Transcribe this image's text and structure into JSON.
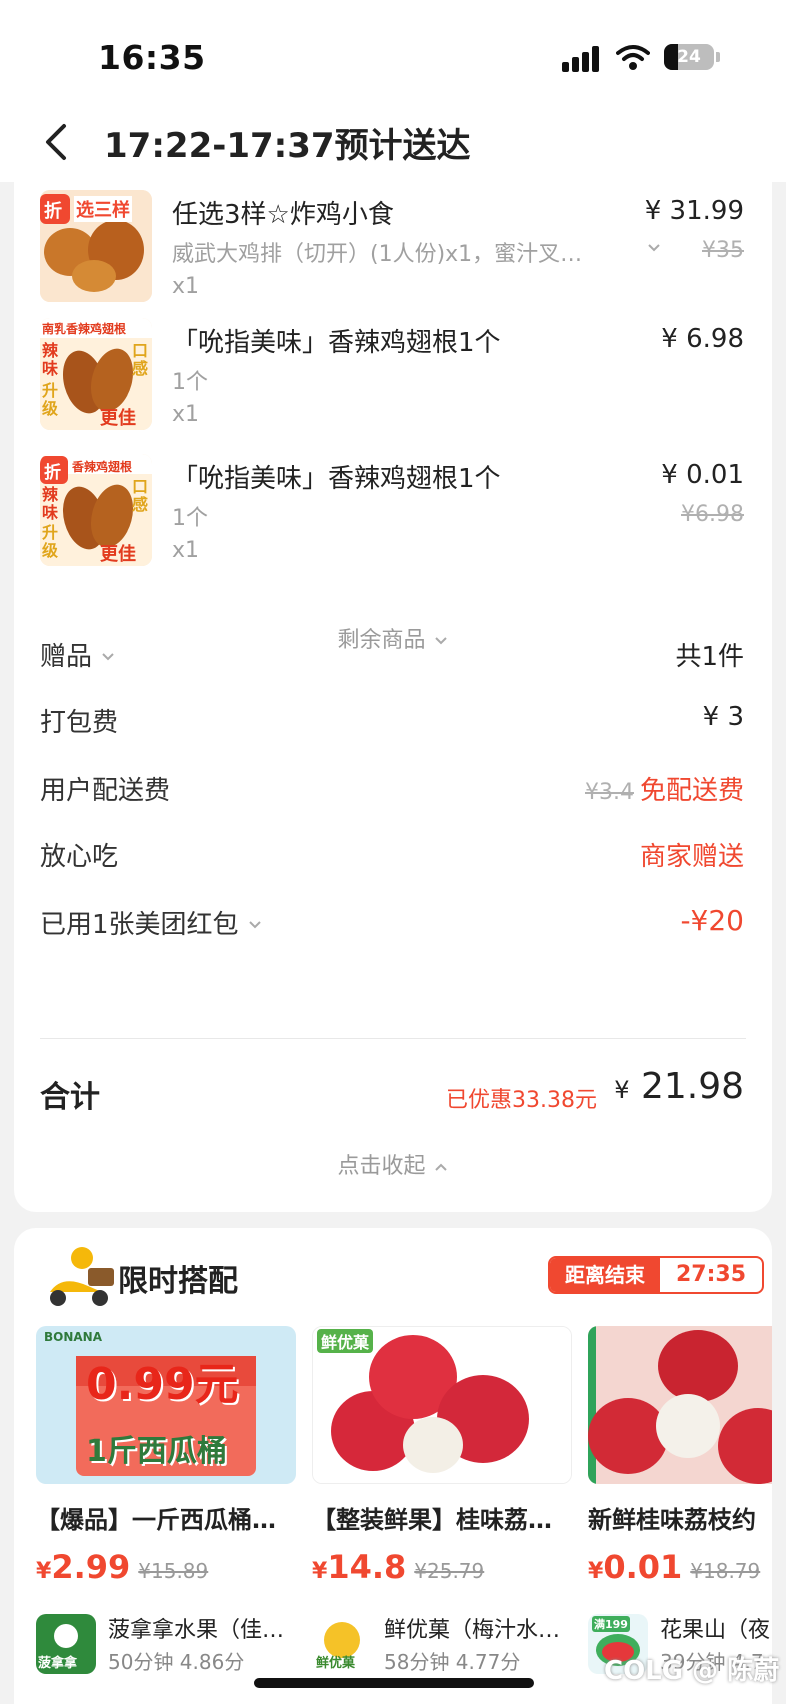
{
  "status_bar": {
    "time": "16:35",
    "battery": "24"
  },
  "header": {
    "title": "17:22-17:37预计送达"
  },
  "items": [
    {
      "name": "任选3样☆炸鸡小食",
      "spec": "威武大鸡排（切开）(1人份)x1，蜜汁叉…",
      "qty": "x1",
      "price": "¥ 31.99",
      "original_price": "¥35",
      "badge": "折",
      "thumb_text": "选三样"
    },
    {
      "name": "「吮指美味」香辣鸡翅根1个",
      "spec": "1个",
      "qty": "x1",
      "price": "¥ 6.98",
      "original_price": "",
      "thumb_top": "南乳香辣鸡翅根",
      "thumb_l1": "辣味",
      "thumb_l2": "升级",
      "thumb_r1": "口感",
      "thumb_r2": "更佳"
    },
    {
      "name": "「吮指美味」香辣鸡翅根1个",
      "spec": "1个",
      "qty": "x1",
      "price": "¥ 0.01",
      "original_price": "¥6.98",
      "badge": "折",
      "thumb_top": "香辣鸡翅根",
      "thumb_l1": "辣味",
      "thumb_l2": "升级",
      "thumb_r1": "口感",
      "thumb_r2": "更佳"
    }
  ],
  "more_items_label": "剩余商品",
  "fees": {
    "gift": {
      "label": "赠品",
      "value": "共1件"
    },
    "packing": {
      "label": "打包费",
      "value": "¥ 3"
    },
    "delivery": {
      "label": "用户配送费",
      "original": "¥3.4",
      "value": "免配送费"
    },
    "safe_eat": {
      "label": "放心吃",
      "value": "商家赠送"
    },
    "red_packet": {
      "label": "已用1张美团红包",
      "value": "-¥20"
    }
  },
  "total": {
    "label": "合计",
    "discount": "已优惠33.38元",
    "currency": "¥",
    "amount": "21.98"
  },
  "collapse_label": "点击收起",
  "combo": {
    "title": "限时搭配",
    "timer_label": "距离结束",
    "timer_value": "27:35",
    "products": [
      {
        "name": "【爆品】一斤西瓜桶…",
        "currency": "¥",
        "price": "2.99",
        "original": "¥15.89",
        "shop": "菠拿拿水果（佳…",
        "meta": "50分钟  4.86分",
        "img_big": "0.99元",
        "img_sub": "1斤西瓜桶",
        "img_brand": "BONANA",
        "logo_text": "菠拿拿"
      },
      {
        "name": "【整装鲜果】桂味荔…",
        "currency": "¥",
        "price": "14.8",
        "original": "¥25.79",
        "shop": "鲜优菓（梅汁水…",
        "meta": "58分钟  4.77分",
        "img_tag": "鲜优菓",
        "logo_text": "鲜优菓"
      },
      {
        "name": "新鲜桂味荔枝约",
        "currency": "¥",
        "price": "0.01",
        "original": "¥18.79",
        "shop": "花果山（夜",
        "meta": "39分钟  4.7",
        "logo_text": "满199"
      }
    ]
  },
  "watermark": "COLG @ 陈蔚"
}
